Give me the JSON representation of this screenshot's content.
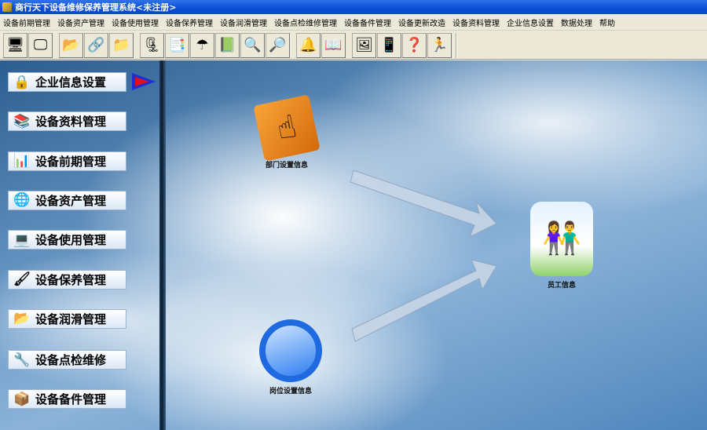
{
  "window": {
    "title": "商行天下设备维修保养管理系统<未注册>"
  },
  "menu": [
    "设备前期管理",
    "设备资产管理",
    "设备使用管理",
    "设备保养管理",
    "设备润滑管理",
    "设备点检维修管理",
    "设备备件管理",
    "设备更新改造",
    "设备资料管理",
    "企业信息设置",
    "数据处理",
    "帮助"
  ],
  "toolbar": {
    "groups": [
      [
        {
          "icon": "monitor-icon",
          "g": "🖥"
        },
        {
          "icon": "screen-icon",
          "g": "🖵"
        }
      ],
      [
        {
          "icon": "folder-open-icon",
          "g": "📂"
        },
        {
          "icon": "network-icon",
          "g": "🔗"
        },
        {
          "icon": "folder-icon",
          "g": "📁"
        }
      ],
      [
        {
          "icon": "zip-folder-icon",
          "g": "🗜"
        },
        {
          "icon": "file-transfer-icon",
          "g": "📑"
        },
        {
          "icon": "umbrella-icon",
          "g": "☂"
        },
        {
          "icon": "notebook-icon",
          "g": "📗"
        },
        {
          "icon": "search-window-icon",
          "g": "🔍"
        },
        {
          "icon": "magnifier-icon",
          "g": "🔎"
        }
      ],
      [
        {
          "icon": "bell-icon",
          "g": "🔔"
        },
        {
          "icon": "open-book-icon",
          "g": "📖"
        }
      ],
      [
        {
          "icon": "picture-icon",
          "g": "🖼"
        },
        {
          "icon": "pda-icon",
          "g": "📱"
        },
        {
          "icon": "help-book-icon",
          "g": "❓"
        },
        {
          "icon": "runner-icon",
          "g": "🏃"
        }
      ]
    ]
  },
  "sidebar": {
    "items": [
      {
        "label": "企业信息设置",
        "icon": "lock-icon",
        "g": "🔒"
      },
      {
        "label": "设备资料管理",
        "icon": "books-icon",
        "g": "📚"
      },
      {
        "label": "设备前期管理",
        "icon": "chart-icon",
        "g": "📊"
      },
      {
        "label": "设备资产管理",
        "icon": "globe-icon",
        "g": "🌐"
      },
      {
        "label": "设备使用管理",
        "icon": "computer-icon",
        "g": "💻"
      },
      {
        "label": "设备保养管理",
        "icon": "paint-icon",
        "g": "🖌"
      },
      {
        "label": "设备润滑管理",
        "icon": "folder-icon",
        "g": "📂"
      },
      {
        "label": "设备点检维修",
        "icon": "drill-icon",
        "g": "🔧"
      },
      {
        "label": "设备备件管理",
        "icon": "box-icon",
        "g": "📦"
      }
    ]
  },
  "workflow": {
    "department": "部门设置信息",
    "position": "岗位设置信息",
    "staff": "员工信息"
  }
}
